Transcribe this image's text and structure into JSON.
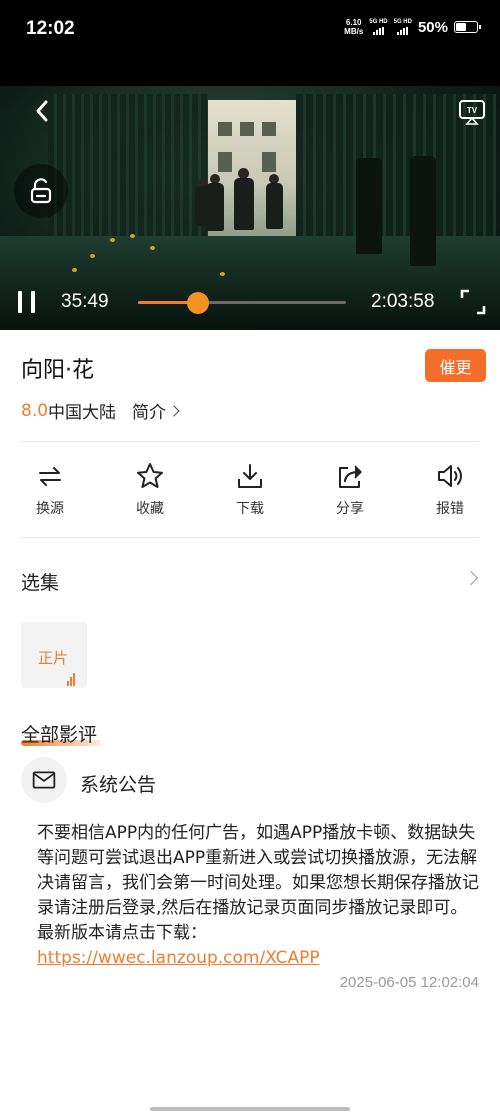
{
  "status_bar": {
    "time": "12:02",
    "net_speed_value": "6.10",
    "net_speed_unit": "MB/s",
    "sim1": "5G HD",
    "sim2": "5G HD",
    "battery": "50%"
  },
  "player": {
    "elapsed": "35:49",
    "duration": "2:03:58",
    "progress_fraction": 0.289,
    "accent": "#f07d2d"
  },
  "movie": {
    "title": "向阳·花",
    "score": "8.0",
    "region": "中国大陆",
    "intro_label": "简介",
    "urge_button": "催更"
  },
  "actions": [
    {
      "label": "换源",
      "icon": "swap-source-icon"
    },
    {
      "label": "收藏",
      "icon": "star-icon"
    },
    {
      "label": "下载",
      "icon": "download-icon"
    },
    {
      "label": "分享",
      "icon": "share-icon"
    },
    {
      "label": "报错",
      "icon": "speaker-report-icon"
    }
  ],
  "episodes": {
    "heading": "选集",
    "items": [
      {
        "label": "正片",
        "playing": true
      }
    ]
  },
  "reviews": {
    "heading": "全部影评",
    "author": "系统公告",
    "body": "不要相信APP内的任何广告，如遇APP播放卡顿、数据缺失等问题可尝试退出APP重新进入或尝试切换播放源，无法解决请留言，我们会第一时间处理。如果您想长期保存播放记录请注册后登录,然后在播放记录页面同步播放记录即可。最新版本请点击下载：",
    "link": "https://wwec.lanzoup.com/XCAPP",
    "timestamp": "2025-06-05 12:02:04"
  }
}
